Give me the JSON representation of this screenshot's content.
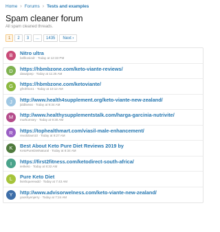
{
  "breadcrumb": {
    "home": "Home",
    "forums": "Forums",
    "section": "Tests and examples"
  },
  "page": {
    "title": "Spam cleaner forum",
    "description": "All spam cleaned threads."
  },
  "pagination": {
    "pages": [
      "1",
      "2",
      "3"
    ],
    "ellipsis": "...",
    "last": "1435",
    "next": "Next ›"
  },
  "threads": [
    {
      "initial": "B",
      "color": "#c94b78",
      "title": "Nitro ultra",
      "author": "bellkosiedr",
      "time": "Today at 12:33 PM"
    },
    {
      "initial": "D",
      "color": "#7fb24f",
      "title": "https://hbmbzone.com/keto-viante-reviews/",
      "author": "dawajoep",
      "time": "Today at 11:25 AM"
    },
    {
      "initial": "G",
      "color": "#8bb83f",
      "title": "https://hbmbzone.com/ketoviante/",
      "author": "gfrohhon1",
      "time": "Today at 10:12 AM"
    },
    {
      "initial": "J",
      "color": "#9fc7e3",
      "title": "http://www.health4supplement.org/keto-viante-new-zealand/",
      "author": "jiddlweas",
      "time": "Today at 9:34 AM"
    },
    {
      "initial": "M",
      "color": "#b44b8a",
      "title": "http://www.healthysupplementstalk.com/harga-garcinia-nutrivite/",
      "author": "murkumsey",
      "time": "Today at 9:30 AM"
    },
    {
      "initial": "R",
      "color": "#9a5ec4",
      "title": "https://tophealthmart.com/viasil-male-enhancement/",
      "author": "rexoldown10",
      "time": "Today at 9:27 AM"
    },
    {
      "initial": "K",
      "color": "#4f7a3d",
      "title": "Best About Keto Pure Diet Reviews 2019 by",
      "author": "KetoPureDietNatural",
      "time": "Today at 8:34 AM"
    },
    {
      "initial": "I",
      "color": "#4aa38b",
      "title": "https://first2fitness.com/ketodirect-south-africa/",
      "author": "ieriketo",
      "time": "Today at 8:32 AM"
    },
    {
      "initial": "L",
      "color": "#a6c43a",
      "title": "Pure Keto Diet",
      "author": "livishquereadd",
      "time": "Today at 7:43 AM"
    },
    {
      "initial": "Y",
      "color": "#3e6ea8",
      "title": "http://www.advisorwelness.com/keto-viante-new-zealand/",
      "author": "yaoshyenjerry",
      "time": "Today at 7:24 AM"
    }
  ]
}
